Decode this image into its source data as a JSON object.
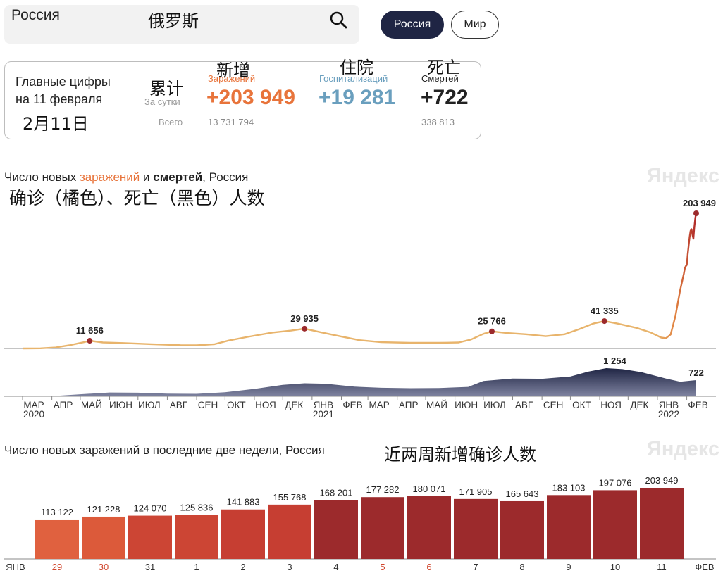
{
  "search": {
    "value": "Россия",
    "annotation_zh": "俄罗斯"
  },
  "tabs": [
    {
      "label": "Россия",
      "active": true
    },
    {
      "label": "Мир",
      "active": false
    }
  ],
  "summary": {
    "heading_line1": "Главные цифры",
    "heading_line2": "на 11 февраля",
    "heading_zh": "2月11日",
    "cumulative_zh": "累计",
    "per_day_label": "За сутки",
    "total_label": "Всего",
    "infections": {
      "zh": "新增",
      "label": "Заражений",
      "daily": "+203 949",
      "total": "13 731 794",
      "color": "#e8743b"
    },
    "hospitalizations": {
      "zh": "住院",
      "label": "Госпитализаций",
      "daily": "+19 281",
      "color": "#6a9fbe"
    },
    "deaths": {
      "zh": "死亡",
      "label": "Смертей",
      "daily": "+722",
      "total": "338 813",
      "color": "#222222"
    }
  },
  "chart1": {
    "title_pre": "Число новых ",
    "title_infections": "заражений",
    "title_mid": " и ",
    "title_deaths": "смертей",
    "title_post": ", Россия",
    "title_zh": "确诊（橘色）、死亡（黑色）人数",
    "watermark": "Яндекс"
  },
  "chart2": {
    "title": "Число новых заражений в последние две недели, Россия",
    "title_zh": "近两周新增确诊人数",
    "watermark": "Яндекс"
  },
  "chart_data": [
    {
      "type": "line",
      "title": "Число новых заражений и смертей, Россия",
      "series": [
        {
          "name": "заражений",
          "color": "#e8b36a",
          "points": [
            [
              "2020-03-01",
              0
            ],
            [
              "2020-03-20",
              250
            ],
            [
              "2020-04-05",
              1500
            ],
            [
              "2020-04-20",
              5000
            ],
            [
              "2020-05-05",
              9500
            ],
            [
              "2020-05-11",
              11656
            ],
            [
              "2020-05-25",
              9000
            ],
            [
              "2020-06-15",
              8200
            ],
            [
              "2020-07-15",
              6500
            ],
            [
              "2020-08-15",
              5000
            ],
            [
              "2020-09-01",
              4800
            ],
            [
              "2020-09-20",
              6500
            ],
            [
              "2020-10-05",
              12000
            ],
            [
              "2020-10-25",
              17500
            ],
            [
              "2020-11-20",
              24000
            ],
            [
              "2020-12-10",
              27000
            ],
            [
              "2020-12-24",
              29935
            ],
            [
              "2021-01-10",
              24500
            ],
            [
              "2021-02-01",
              18000
            ],
            [
              "2021-02-20",
              12500
            ],
            [
              "2021-03-15",
              9500
            ],
            [
              "2021-04-15",
              8500
            ],
            [
              "2021-05-15",
              8500
            ],
            [
              "2021-06-05",
              9000
            ],
            [
              "2021-06-18",
              13500
            ],
            [
              "2021-07-01",
              22000
            ],
            [
              "2021-07-10",
              25766
            ],
            [
              "2021-07-25",
              23500
            ],
            [
              "2021-08-15",
              21500
            ],
            [
              "2021-09-05",
              18500
            ],
            [
              "2021-09-25",
              21500
            ],
            [
              "2021-10-10",
              29000
            ],
            [
              "2021-10-25",
              37500
            ],
            [
              "2021-11-06",
              41335
            ],
            [
              "2021-11-20",
              37500
            ],
            [
              "2021-12-10",
              31000
            ],
            [
              "2021-12-25",
              24000
            ],
            [
              "2022-01-05",
              16500
            ],
            [
              "2022-01-10",
              15500
            ],
            [
              "2022-01-15",
              21000
            ],
            [
              "2022-01-20",
              49000
            ],
            [
              "2022-01-25",
              88000
            ],
            [
              "2022-01-29",
              113122
            ],
            [
              "2022-01-30",
              121228
            ],
            [
              "2022-01-31",
              124070
            ],
            [
              "2022-02-01",
              125836
            ],
            [
              "2022-02-02",
              141883
            ],
            [
              "2022-02-03",
              155768
            ],
            [
              "2022-02-04",
              168201
            ],
            [
              "2022-02-05",
              177282
            ],
            [
              "2022-02-06",
              180071
            ],
            [
              "2022-02-07",
              171905
            ],
            [
              "2022-02-08",
              165643
            ],
            [
              "2022-02-09",
              183103
            ],
            [
              "2022-02-10",
              197076
            ],
            [
              "2022-02-11",
              203949
            ]
          ],
          "labels": [
            [
              "2020-05-11",
              "11 656"
            ],
            [
              "2020-12-24",
              "29 935"
            ],
            [
              "2021-07-10",
              "25 766"
            ],
            [
              "2021-11-06",
              "41 335"
            ],
            [
              "2022-02-11",
              "203 949"
            ]
          ]
        },
        {
          "name": "смертей",
          "color": "#2a2f4f",
          "points": [
            [
              "2020-03-01",
              0
            ],
            [
              "2020-04-01",
              5
            ],
            [
              "2020-05-01",
              90
            ],
            [
              "2020-06-01",
              170
            ],
            [
              "2020-07-01",
              160
            ],
            [
              "2020-08-01",
              120
            ],
            [
              "2020-09-01",
              110
            ],
            [
              "2020-10-01",
              180
            ],
            [
              "2020-11-01",
              330
            ],
            [
              "2020-12-01",
              510
            ],
            [
              "2020-12-24",
              580
            ],
            [
              "2021-01-15",
              560
            ],
            [
              "2021-02-15",
              430
            ],
            [
              "2021-03-15",
              380
            ],
            [
              "2021-04-15",
              360
            ],
            [
              "2021-05-15",
              370
            ],
            [
              "2021-06-15",
              420
            ],
            [
              "2021-07-01",
              680
            ],
            [
              "2021-08-01",
              790
            ],
            [
              "2021-09-01",
              780
            ],
            [
              "2021-10-01",
              880
            ],
            [
              "2021-10-20",
              1100
            ],
            [
              "2021-11-08",
              1254
            ],
            [
              "2021-11-25",
              1210
            ],
            [
              "2021-12-15",
              1080
            ],
            [
              "2022-01-10",
              790
            ],
            [
              "2022-01-25",
              650
            ],
            [
              "2022-02-11",
              722
            ]
          ],
          "labels": [
            [
              "2021-11-08",
              "1 254"
            ],
            [
              "2022-02-11",
              "722"
            ]
          ]
        }
      ],
      "x_ticks": [
        "МАР",
        "АПР",
        "МАЙ",
        "ИЮН",
        "ИЮЛ",
        "АВГ",
        "СЕН",
        "ОКТ",
        "НОЯ",
        "ДЕК",
        "ЯНВ",
        "ФЕВ",
        "МАР",
        "АПР",
        "МАЙ",
        "ИЮН",
        "ИЮЛ",
        "АВГ",
        "СЕН",
        "ОКТ",
        "НОЯ",
        "ДЕК",
        "ЯНВ",
        "ФЕВ"
      ],
      "year_labels": [
        "2020",
        "2021",
        "2022"
      ],
      "x_range": [
        "2020-03-01",
        "2022-02-11"
      ]
    },
    {
      "type": "bar",
      "title": "Число новых заражений в последние две недели, Россия",
      "categories": [
        "29",
        "30",
        "31",
        "1",
        "2",
        "3",
        "4",
        "5",
        "6",
        "7",
        "8",
        "9",
        "10",
        "11"
      ],
      "values": [
        113122,
        121228,
        124070,
        125836,
        141883,
        155768,
        168201,
        177282,
        180071,
        171905,
        165643,
        183103,
        197076,
        203949
      ],
      "value_labels": [
        "113 122",
        "121 228",
        "124 070",
        "125 836",
        "141 883",
        "155 768",
        "168 201",
        "177 282",
        "180 071",
        "171 905",
        "165 643",
        "183 103",
        "197 076",
        "203 949"
      ],
      "bar_colors": [
        "#e0613f",
        "#dc5a3a",
        "#cc4534",
        "#cc4534",
        "#c63e32",
        "#c63e32",
        "#9c2a2c",
        "#9c2a2c",
        "#9c2a2c",
        "#9c2a2c",
        "#9c2a2c",
        "#9c2a2c",
        "#9c2a2c",
        "#9c2a2c"
      ],
      "weekend": [
        true,
        true,
        false,
        false,
        false,
        false,
        false,
        true,
        true,
        false,
        false,
        false,
        false,
        false
      ],
      "month_start_label": "ЯНВ",
      "month_end_label": "ФЕВ",
      "ylim": [
        0,
        210000
      ]
    }
  ]
}
